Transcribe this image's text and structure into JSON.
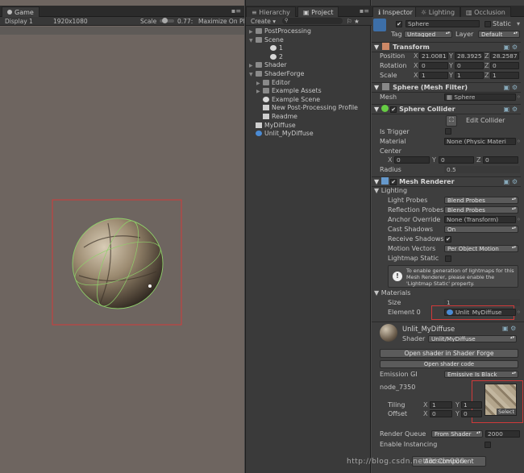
{
  "game": {
    "tab_label": "Game",
    "display": "Display 1",
    "resolution": "1920x1080",
    "scale_label": "Scale",
    "scale_value": "0.77:",
    "maximize": "Maximize On Pla"
  },
  "hierarchy": {
    "tab_label": "Hierarchy",
    "project_tab_label": "Project",
    "create_label": "Create",
    "items": [
      {
        "label": "PostProcessing",
        "type": "folder",
        "indent": 0,
        "arrow": "▶"
      },
      {
        "label": "Scene",
        "type": "folder",
        "indent": 0,
        "arrow": "▼"
      },
      {
        "label": "1",
        "type": "unity",
        "indent": 2,
        "arrow": ""
      },
      {
        "label": "2",
        "type": "unity",
        "indent": 2,
        "arrow": ""
      },
      {
        "label": "Shader",
        "type": "folder",
        "indent": 0,
        "arrow": "▶"
      },
      {
        "label": "ShaderForge",
        "type": "folder",
        "indent": 0,
        "arrow": "▼"
      },
      {
        "label": "Editor",
        "type": "folder",
        "indent": 1,
        "arrow": "▶"
      },
      {
        "label": "Example Assets",
        "type": "folder",
        "indent": 1,
        "arrow": "▶"
      },
      {
        "label": "Example Scene",
        "type": "unity",
        "indent": 1,
        "arrow": ""
      },
      {
        "label": "New Post-Processing Profile",
        "type": "doc",
        "indent": 1,
        "arrow": ""
      },
      {
        "label": "Readme",
        "type": "doc",
        "indent": 1,
        "arrow": ""
      },
      {
        "label": "MyDiffuse",
        "type": "doc",
        "indent": 0,
        "arrow": ""
      },
      {
        "label": "Unlit_MyDiffuse",
        "type": "mat",
        "indent": 0,
        "arrow": ""
      }
    ]
  },
  "inspector": {
    "tab_label": "Inspector",
    "lighting_tab": "Lighting",
    "occlusion_tab": "Occlusion",
    "object_name": "Sphere",
    "static_label": "Static",
    "tag_label": "Tag",
    "tag_value": "Untagged",
    "layer_label": "Layer",
    "layer_value": "Default",
    "transform": {
      "title": "Transform",
      "position_label": "Position",
      "rotation_label": "Rotation",
      "scale_label": "Scale",
      "position": {
        "x": "21.0081",
        "y": "28.3925",
        "z": "28.2587"
      },
      "rotation": {
        "x": "0",
        "y": "0",
        "z": "0"
      },
      "scale": {
        "x": "1",
        "y": "1",
        "z": "1"
      }
    },
    "mesh_filter": {
      "title": "Sphere (Mesh Filter)",
      "mesh_label": "Mesh",
      "mesh_value": "Sphere"
    },
    "collider": {
      "title": "Sphere Collider",
      "edit_label": "Edit Collider",
      "is_trigger_label": "Is Trigger",
      "material_label": "Material",
      "material_value": "None (Physic Materi",
      "center_label": "Center",
      "center": {
        "x": "0",
        "y": "0",
        "z": "0"
      },
      "radius_label": "Radius",
      "radius_value": "0.5"
    },
    "renderer": {
      "title": "Mesh Renderer",
      "lighting_label": "Lighting",
      "light_probes_label": "Light Probes",
      "light_probes_value": "Blend Probes",
      "reflection_probes_label": "Reflection Probes",
      "reflection_probes_value": "Blend Probes",
      "anchor_override_label": "Anchor Override",
      "anchor_override_value": "None (Transform)",
      "cast_shadows_label": "Cast Shadows",
      "cast_shadows_value": "On",
      "receive_shadows_label": "Receive Shadows",
      "motion_vectors_label": "Motion Vectors",
      "motion_vectors_value": "Per Object Motion",
      "lightmap_static_label": "Lightmap Static",
      "info_text": "To enable generation of lightmaps for this Mesh Renderer, please enable the 'Lightmap Static' property.",
      "materials_label": "Materials",
      "size_label": "Size",
      "size_value": "1",
      "element0_label": "Element 0",
      "element0_value": "Unlit_MyDiffuse"
    },
    "material": {
      "name": "Unlit_MyDiffuse",
      "shader_label": "Shader",
      "shader_value": "Unlit/MyDiffuse",
      "open_forge": "Open shader in Shader Forge",
      "open_code": "Open shader code",
      "emission_label": "Emission GI",
      "emission_value": "Emissive Is Black",
      "node_label": "node_7350",
      "tiling_label": "Tiling",
      "offset_label": "Offset",
      "tiling": {
        "x": "1",
        "y": "1"
      },
      "offset": {
        "x": "0",
        "y": "0"
      },
      "select_label": "Select",
      "render_queue_label": "Render Queue",
      "render_queue_mode": "From Shader",
      "render_queue_value": "2000",
      "instancing_label": "Enable Instancing",
      "add_component": "Add Component"
    }
  },
  "watermark": "http://blog.csdn.net/lcsdn000",
  "colors": {
    "highlight": "#d03a3a",
    "collider_wire": "#8fd16a",
    "game_bg": "#6e6560"
  }
}
